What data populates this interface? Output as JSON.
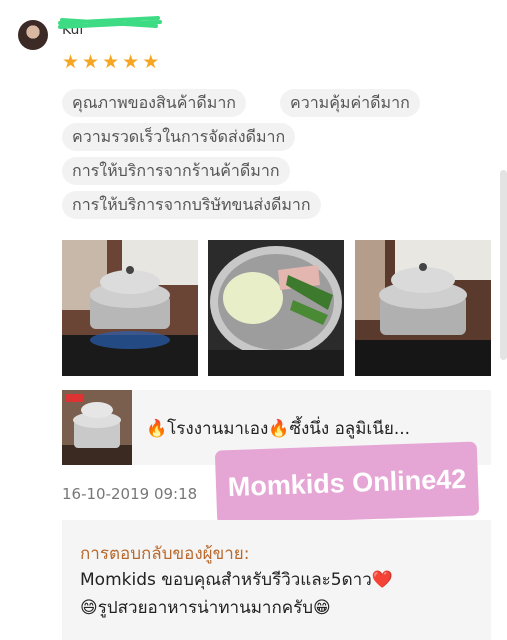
{
  "review": {
    "username": "Kul",
    "rating": 5,
    "star_glyph": "★",
    "tags": [
      "คุณภาพของสินค้าดีมาก",
      "ความคุ้มค่าดีมาก",
      "ความรวดเร็วในการจัดส่งดีมาก",
      "การให้บริการจากร้านค้าดีมาก",
      "การให้บริการจากบริษัทขนส่งดีมาก"
    ],
    "date": "16-10-2019 09:18"
  },
  "product": {
    "name": "🔥โรงงานมาเอง🔥ซึ้งนึ่ง อลูมิเนีย..."
  },
  "watermark": "Momkids Online42",
  "seller_reply": {
    "title": "การตอบกลับของผู้ขาย:",
    "line1": "Momkids ขอบคุณสำหรับรีวิวและ5ดาว❤️",
    "line2": "😄รูปสวยอาหารน่าทานมากครับ😁"
  },
  "colors": {
    "star": "#f6a623",
    "reply_title": "#b86a2e",
    "watermark_bg": "#e6a6d5",
    "tag_bg": "#f2f2f2"
  },
  "icons": [
    "star-icon",
    "user-avatar",
    "steamer-photo"
  ]
}
